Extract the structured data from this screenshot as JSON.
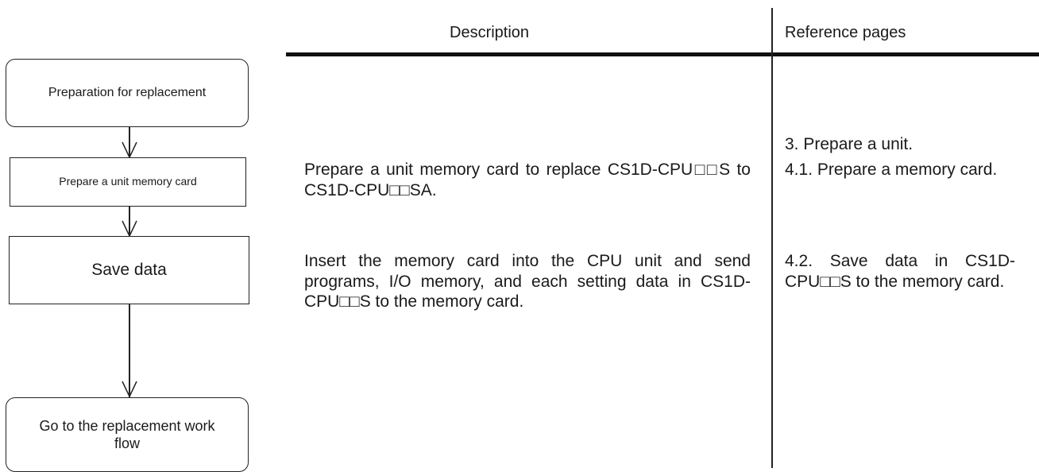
{
  "table": {
    "header_description": "Description",
    "header_reference": "Reference pages"
  },
  "flow": {
    "step1": "Preparation for replacement",
    "step2": "Prepare a unit memory card",
    "step3": "Save data",
    "step4": "Go to the replacement work flow"
  },
  "rows": [
    {
      "description": "Prepare a unit memory card to replace CS1D-CPU□□S to CS1D-CPU□□SA.",
      "references": [
        "3. Prepare a unit.",
        "4.1. Prepare a memory card."
      ]
    },
    {
      "description": "Insert the memory card into the CPU unit and send programs, I/O memory, and each setting data in CS1D-CPU□□S to the memory card.",
      "references": [
        "4.2. Save data in CS1D-CPU□□S to the memory card."
      ]
    }
  ]
}
